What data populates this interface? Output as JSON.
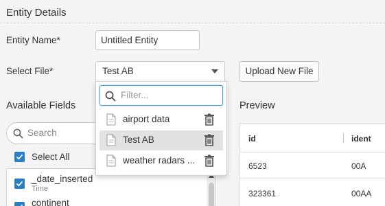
{
  "section": {
    "title": "Entity Details"
  },
  "entity_name": {
    "label": "Entity Name*",
    "value": "Untitled Entity"
  },
  "select_file": {
    "label": "Select File*",
    "selected": "Test AB"
  },
  "upload": {
    "label": "Upload New File"
  },
  "available_fields": {
    "title": "Available Fields",
    "search_placeholder": "Search",
    "select_all": "Select All",
    "fields": [
      {
        "name": "_date_inserted",
        "type": "Time"
      },
      {
        "name": "continent",
        "type": ""
      }
    ]
  },
  "preview": {
    "title": "Preview",
    "columns": [
      "id",
      "ident"
    ],
    "rows": [
      [
        "6523",
        "00A"
      ],
      [
        "323361",
        "00AA"
      ]
    ]
  },
  "dropdown": {
    "filter_placeholder": "Filter...",
    "options": [
      {
        "label": "airport data"
      },
      {
        "label": "Test AB"
      },
      {
        "label": "weather radars ..."
      }
    ]
  },
  "colors": {
    "accent": "#2a7ec6",
    "focus": "#4aa0d8",
    "selected_row": "#e2e2e2"
  },
  "icons": [
    "search-icon",
    "caret-down-icon",
    "document-icon",
    "trash-icon",
    "checkbox-checked-icon"
  ]
}
